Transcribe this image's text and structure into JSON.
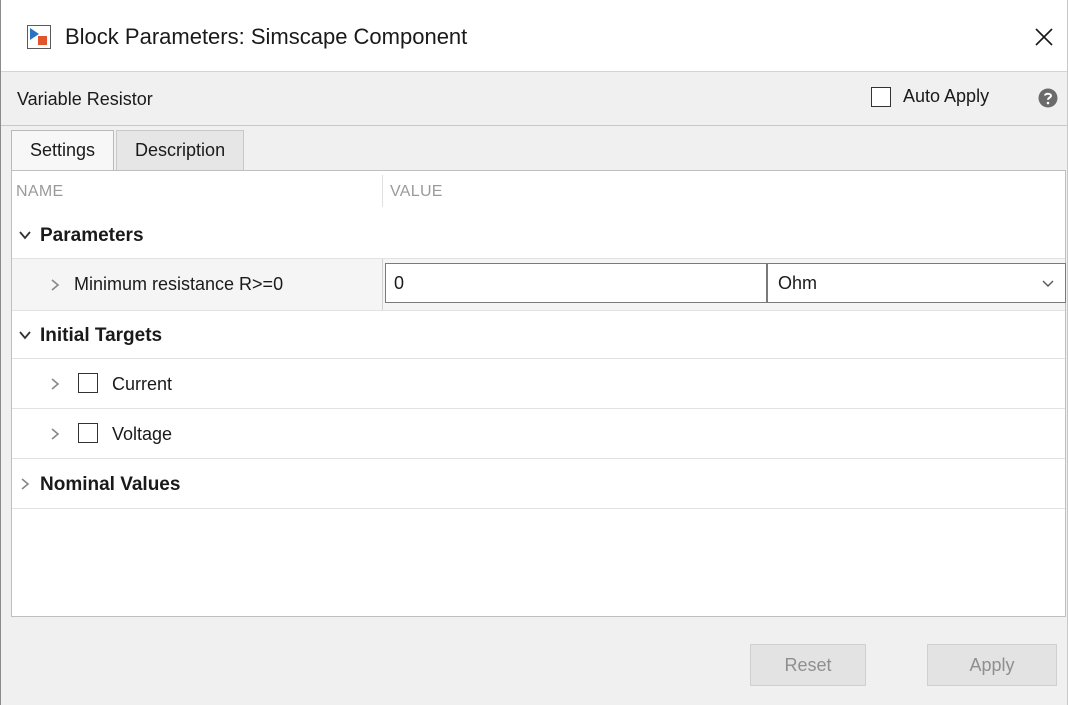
{
  "window": {
    "title": "Block Parameters: Simscape Component",
    "app_icon": "simulink-block-icon",
    "close_icon": "close-icon"
  },
  "header": {
    "block_name": "Variable Resistor",
    "auto_apply_label": "Auto Apply",
    "auto_apply_checked": false,
    "help_icon": "help-icon"
  },
  "tabs": [
    {
      "label": "Settings",
      "active": true
    },
    {
      "label": "Description",
      "active": false
    }
  ],
  "table": {
    "columns": {
      "name": "NAME",
      "value": "VALUE"
    },
    "groups": {
      "parameters": {
        "label": "Parameters",
        "expanded": true,
        "rows": [
          {
            "label": "Minimum resistance R>=0",
            "value": "0",
            "unit": "Ohm"
          }
        ]
      },
      "initial_targets": {
        "label": "Initial Targets",
        "expanded": true,
        "rows": [
          {
            "label": "Current",
            "checked": false
          },
          {
            "label": "Voltage",
            "checked": false
          }
        ]
      },
      "nominal_values": {
        "label": "Nominal Values",
        "expanded": false
      }
    }
  },
  "footer": {
    "reset_label": "Reset",
    "apply_label": "Apply"
  },
  "colors": {
    "panel_bg": "#f0f0f0",
    "disabled_text": "#8f8f8f"
  }
}
